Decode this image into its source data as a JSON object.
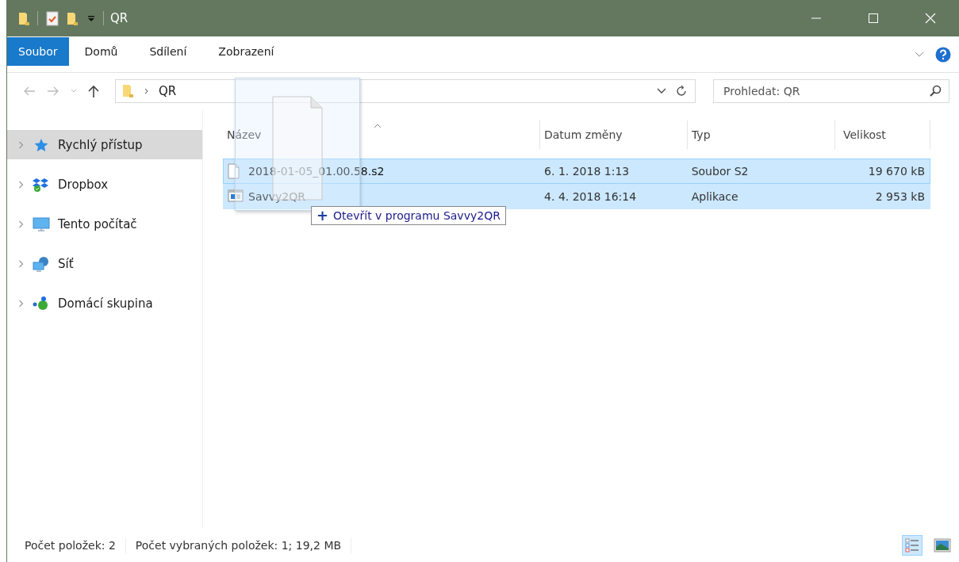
{
  "window": {
    "title": "QR"
  },
  "ribbon_tabs": [
    {
      "label": "Soubor",
      "selected": true
    },
    {
      "label": "Domů",
      "selected": false
    },
    {
      "label": "Sdílení",
      "selected": false
    },
    {
      "label": "Zobrazení",
      "selected": false
    }
  ],
  "address": {
    "path": [
      "QR"
    ]
  },
  "search": {
    "placeholder": "Prohledat: QR"
  },
  "sidebar": {
    "items": [
      {
        "label": "Rychlý přístup",
        "kind": "quick",
        "selected": true
      },
      {
        "label": "Dropbox",
        "kind": "dropbox",
        "selected": false
      },
      {
        "label": "Tento počítač",
        "kind": "pc",
        "selected": false
      },
      {
        "label": "Síť",
        "kind": "network",
        "selected": false
      },
      {
        "label": "Domácí skupina",
        "kind": "homegroup",
        "selected": false
      }
    ]
  },
  "table": {
    "columns": [
      "Název",
      "Datum změny",
      "Typ",
      "Velikost"
    ],
    "rows": [
      {
        "kind": "file",
        "cells": [
          "2018-01-05_01.00.58.s2",
          "6. 1. 2018 1:13",
          "Soubor S2",
          "19 670 kB"
        ],
        "selected": true,
        "focused": true
      },
      {
        "kind": "app",
        "cells": [
          "Savvy2QR",
          "4. 4. 2018 16:14",
          "Aplikace",
          "2 953 kB"
        ],
        "selected": true,
        "focused": false
      }
    ]
  },
  "drag_tooltip": {
    "icon": "+",
    "text": "Otevřít v programu Savvy2QR"
  },
  "status_bar": {
    "item_count": "Počet položek: 2",
    "selection": "Počet vybraných položek: 1; 19,2 MB"
  },
  "view_buttons": [
    {
      "kind": "details",
      "selected": true
    },
    {
      "kind": "tiles",
      "selected": false
    }
  ]
}
